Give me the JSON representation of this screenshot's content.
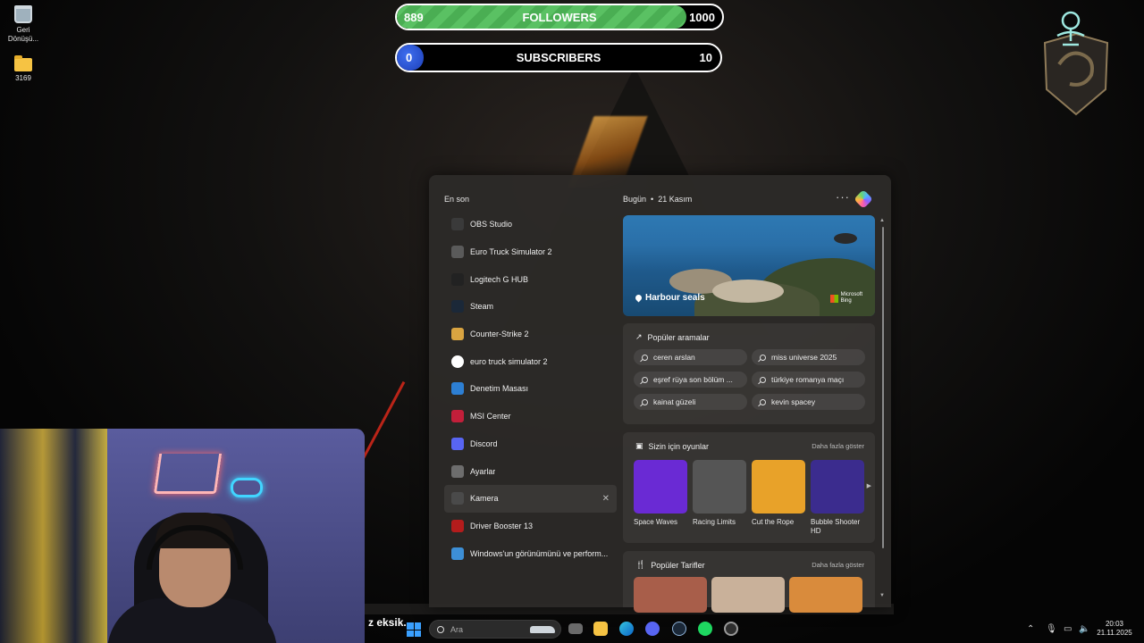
{
  "desktop": {
    "icons": [
      {
        "name": "recycle-bin",
        "label": "Geri Dönüşü..."
      },
      {
        "name": "folder",
        "label": "3169"
      }
    ]
  },
  "overlay": {
    "followers": {
      "current": "889",
      "label": "FOLLOWERS",
      "goal": "1000",
      "progress": 0.889,
      "color": "#55bb5e"
    },
    "subscribers": {
      "current": "0",
      "label": "SUBSCRIBERS",
      "goal": "10",
      "progress": 0.0,
      "color": "#2f5be0"
    },
    "ticker_text": "z eksik."
  },
  "start_panel": {
    "recent_title": "En son",
    "recent": [
      {
        "label": "OBS Studio",
        "icon": "obs-icon",
        "color": "#3a3a3a"
      },
      {
        "label": "Euro Truck Simulator 2",
        "icon": "truck-icon",
        "color": "#5a5a5a"
      },
      {
        "label": "Logitech G HUB",
        "icon": "logitech-icon",
        "color": "#222222"
      },
      {
        "label": "Steam",
        "icon": "steam-icon",
        "color": "#1b2838"
      },
      {
        "label": "Counter-Strike 2",
        "icon": "cs2-icon",
        "color": "#d9a441"
      },
      {
        "label": "euro truck simulator 2",
        "icon": "search-icon",
        "color": "#ffffff"
      },
      {
        "label": "Denetim Masası",
        "icon": "control-panel-icon",
        "color": "#2d7fd3"
      },
      {
        "label": "MSI Center",
        "icon": "msi-center-icon",
        "color": "#c21f3a"
      },
      {
        "label": "Discord",
        "icon": "discord-icon",
        "color": "#5865f2"
      },
      {
        "label": "Ayarlar",
        "icon": "settings-icon",
        "color": "#6d6d6d"
      },
      {
        "label": "Kamera",
        "icon": "camera-icon",
        "color": "#4a4a4a",
        "highlighted": true
      },
      {
        "label": "Driver Booster 13",
        "icon": "driver-booster-icon",
        "color": "#b31c1c"
      },
      {
        "label": "Windows'un görünümünü ve perform...",
        "icon": "performance-icon",
        "color": "#3d8fd6"
      }
    ],
    "today_label": "Bugün",
    "today_date": "21 Kasım",
    "hero": {
      "title": "Harbour seals",
      "brand_line1": "Microsoft",
      "brand_line2": "Bing"
    },
    "popular": {
      "title": "Popüler aramalar",
      "items": [
        "ceren arslan",
        "miss universe 2025",
        "eşref rüya son bölüm ...",
        "türkiye romanya maçı",
        "kainat güzeli",
        "kevin spacey"
      ]
    },
    "games": {
      "title": "Sizin için oyunlar",
      "more": "Daha fazla göster",
      "items": [
        {
          "name": "Space Waves",
          "color": "#6a2ad4"
        },
        {
          "name": "Racing Limits",
          "color": "#555555"
        },
        {
          "name": "Cut the Rope",
          "color": "#e8a229"
        },
        {
          "name": "Bubble Shooter HD",
          "color": "#3b2c8e"
        }
      ]
    },
    "recipes": {
      "title": "Popüler Tarifler",
      "more": "Daha fazla göster",
      "items": [
        {
          "color": "#a85e4a"
        },
        {
          "color": "#c9b19a"
        },
        {
          "color": "#d98b3c"
        }
      ]
    }
  },
  "taskbar": {
    "search_placeholder": "Ara",
    "clock_time": "20:03",
    "clock_date": "21.11.2025"
  }
}
